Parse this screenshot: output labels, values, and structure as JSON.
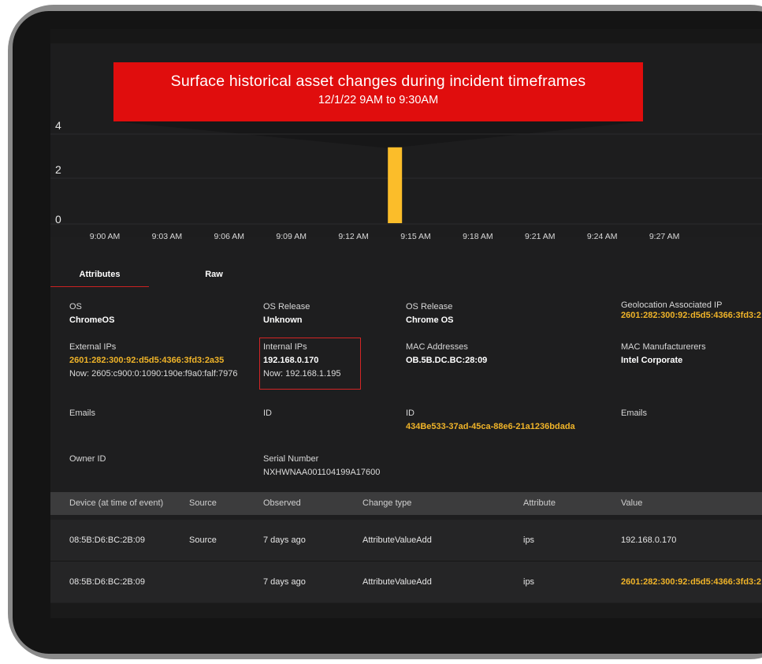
{
  "banner": {
    "title": "Surface historical asset changes during incident timeframes",
    "subtitle": "12/1/22 9AM to 9:30AM",
    "color": "#e00d0d"
  },
  "chart_data": {
    "type": "bar",
    "title": "",
    "xlabel": "",
    "ylabel": "",
    "y_ticks": [
      "4",
      "2",
      "0"
    ],
    "ylim": [
      0,
      4
    ],
    "x_ticks": [
      "9:00 AM",
      "9:03 AM",
      "9:06 AM",
      "9:09 AM",
      "9:12 AM",
      "9:15 AM",
      "9:18 AM",
      "9:21 AM",
      "9:24 AM",
      "9:27 AM"
    ],
    "bars": [
      {
        "x": "9:14 AM",
        "value": 3.4
      }
    ],
    "bar_color": "#fbbd2a",
    "grid": true
  },
  "tabs": [
    {
      "label": "Attributes",
      "active": true
    },
    {
      "label": "Raw",
      "active": false
    }
  ],
  "attributes": {
    "os": {
      "label": "OS",
      "value": "ChromeOS"
    },
    "os_release_1": {
      "label": "OS Release",
      "value": "Unknown"
    },
    "os_release_2": {
      "label": "OS Release",
      "value": "Chrome OS"
    },
    "geo_ip": {
      "label": "Geolocation Associated IP",
      "value": "2601:282:300:92:d5d5:4366:3fd3:2"
    },
    "external_ips": {
      "label": "External IPs",
      "value": "2601:282:300:92:d5d5:4366:3fd3:2a35",
      "now": "Now: 2605:c900:0:1090:190e:f9a0:falf:7976"
    },
    "internal_ips": {
      "label": "Internal IPs",
      "value": "192.168.0.170",
      "now": "Now: 192.168.1.195"
    },
    "mac_addresses": {
      "label": "MAC Addresses",
      "value": "OB.5B.DC.BC:28:09"
    },
    "mac_manufacturers": {
      "label": "MAC Manufacturerers",
      "value": "Intel Corporate"
    },
    "emails_1": {
      "label": "Emails"
    },
    "id_1": {
      "label": "ID"
    },
    "id_2": {
      "label": "ID",
      "value": "434Be533-37ad-45ca-88e6-21a1236bdada"
    },
    "emails_2": {
      "label": "Emails"
    },
    "owner_id": {
      "label": "Owner ID"
    },
    "serial": {
      "label": "Serial Number",
      "value": "NXHWNAA001104199A17600"
    }
  },
  "table": {
    "headers": [
      "Device (at time of event)",
      "Source",
      "Observed",
      "Change type",
      "Attribute",
      "Value"
    ],
    "rows": [
      [
        "08:5B:D6:BC:2B:09",
        "Source",
        "7 days ago",
        "AttributeValueAdd",
        "ips",
        "192.168.0.170"
      ],
      [
        "08:5B:D6:BC:2B:09",
        "",
        "7 days ago",
        "AttributeValueAdd",
        "ips",
        "2601:282:300:92:d5d5:4366:3fd3:2"
      ]
    ]
  },
  "colors": {
    "accent_yellow": "#f0b429",
    "highlight_red": "#d42525",
    "background": "#1e1e1f"
  }
}
